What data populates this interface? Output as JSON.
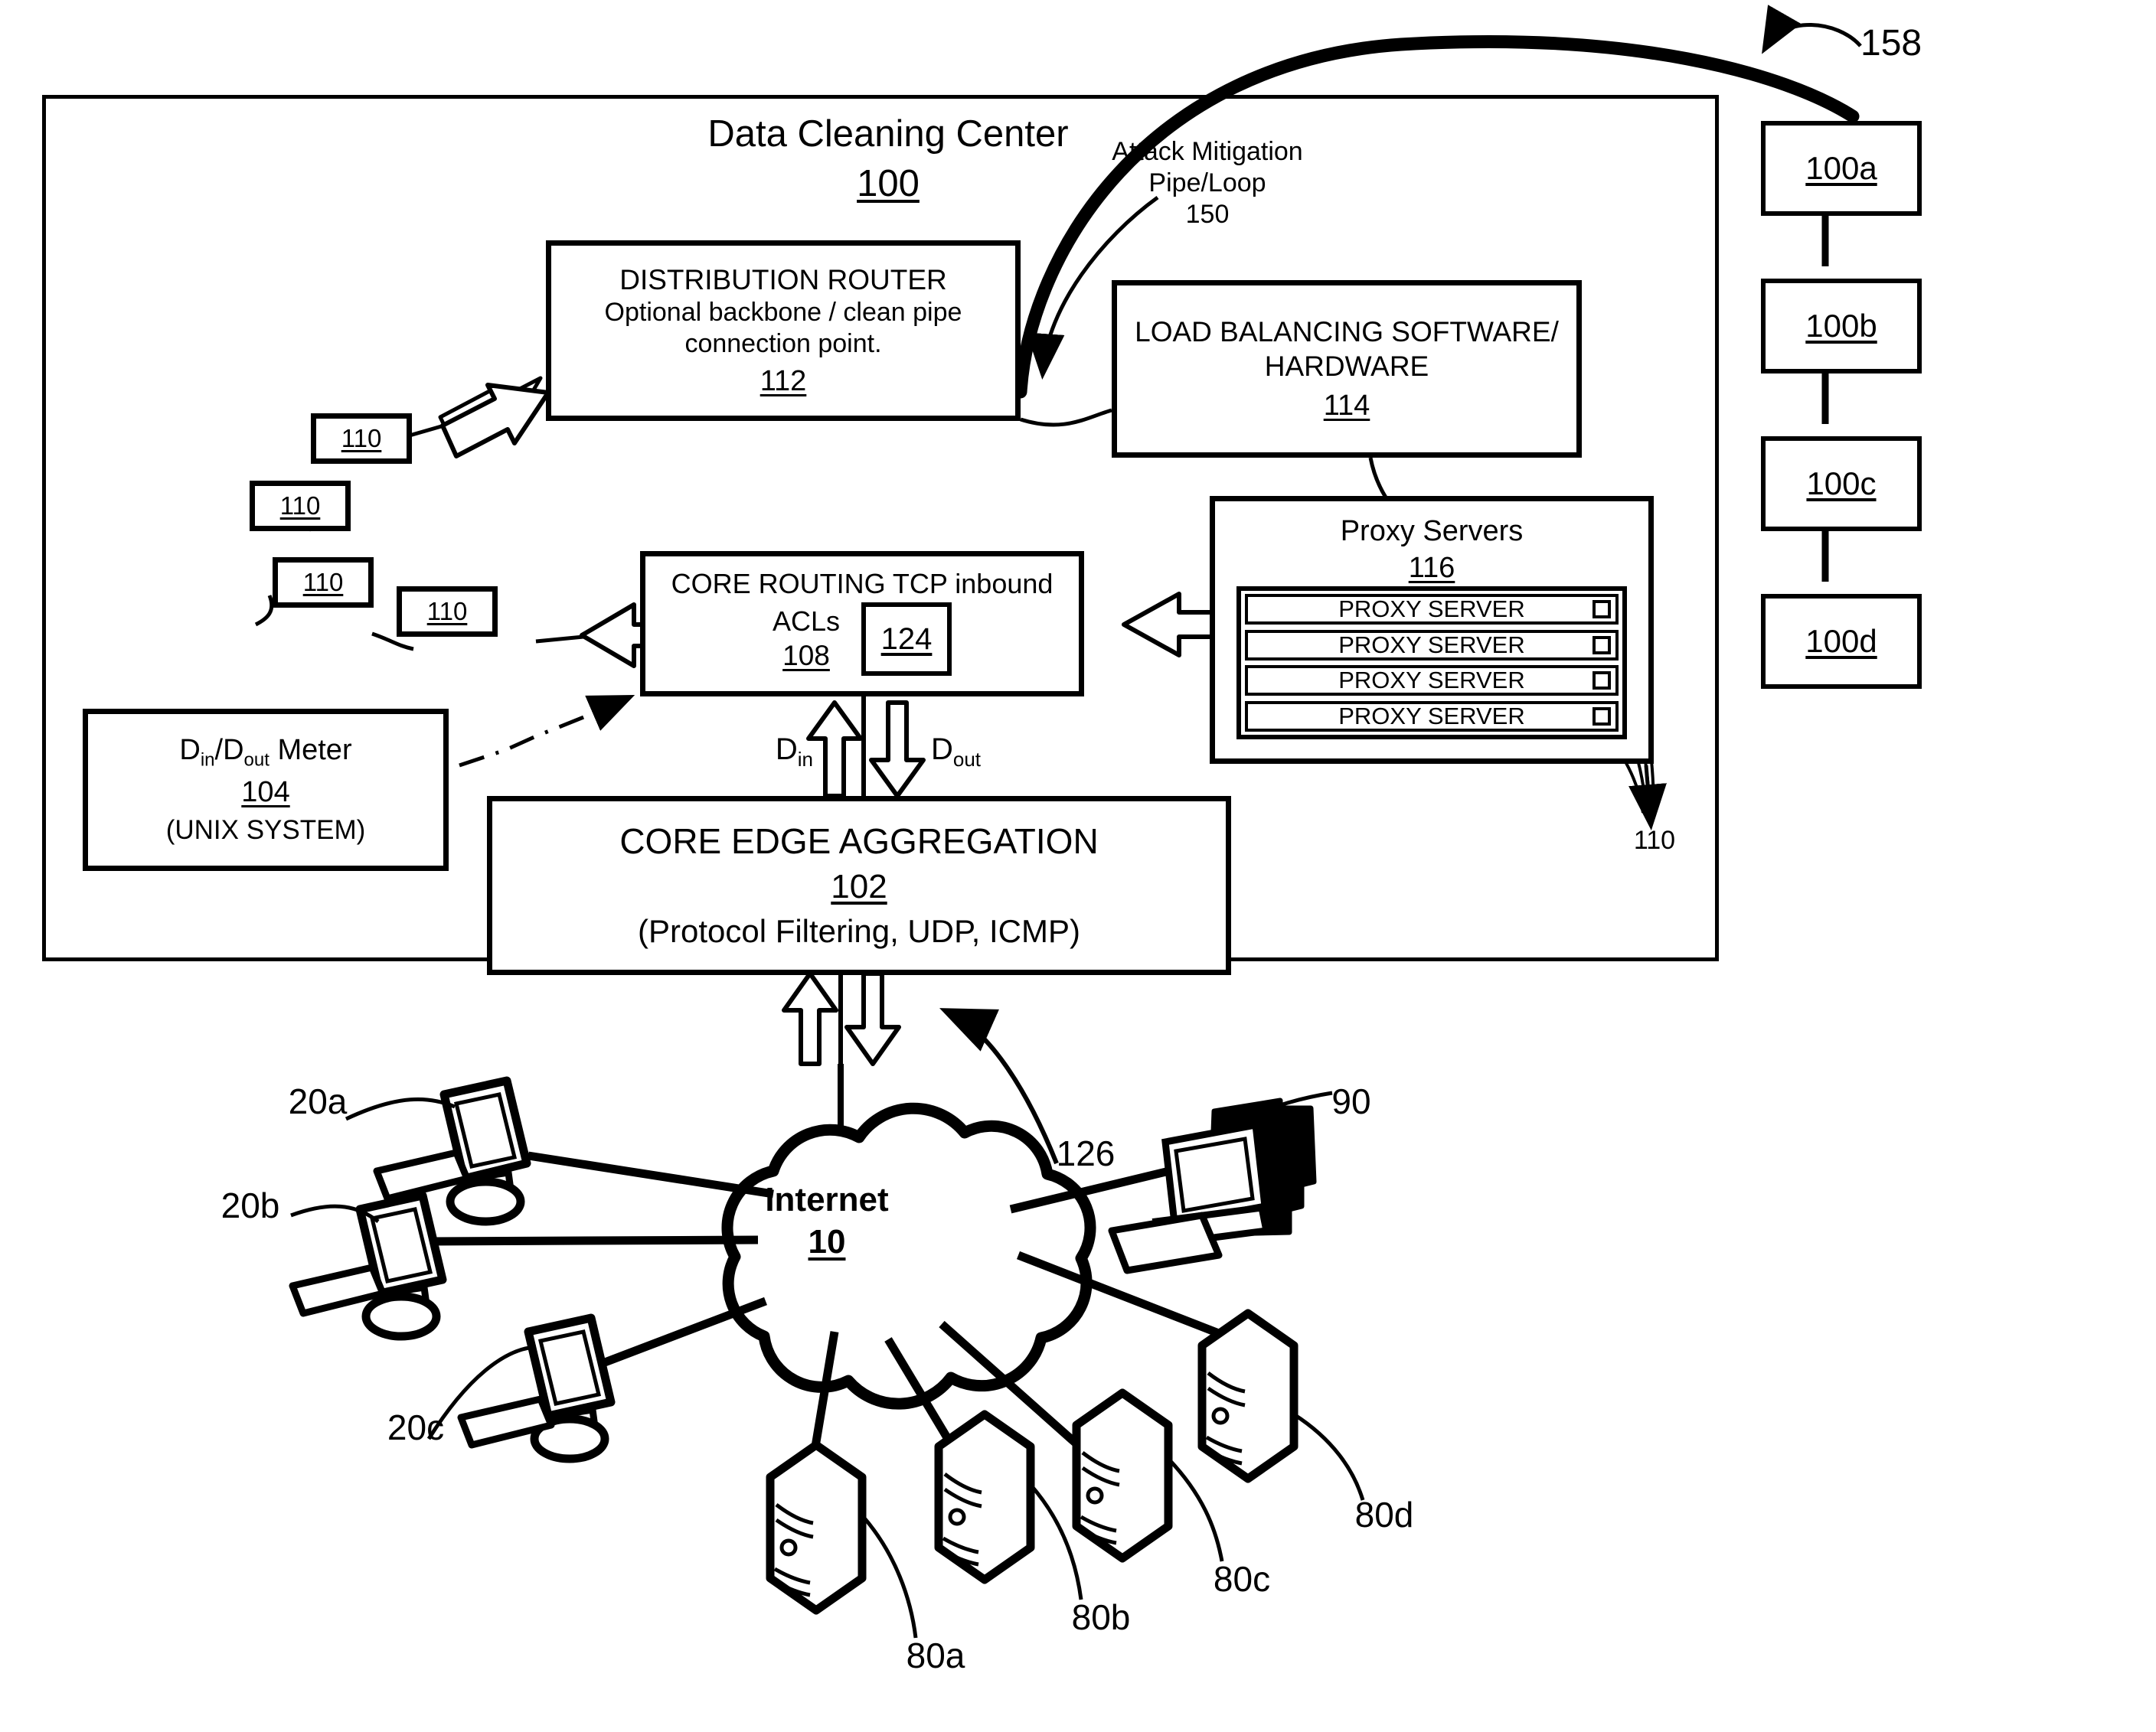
{
  "figure": {
    "center": {
      "title": "Data Cleaning Center",
      "ref": "100"
    },
    "pipe_label": {
      "line1": "Attack Mitigation",
      "line2": "Pipe/Loop",
      "ref": "150"
    },
    "callout_158": "158"
  },
  "boxes": {
    "distribution_router": {
      "title": "DISTRIBUTION ROUTER",
      "line2": "Optional backbone / clean pipe",
      "line3": "connection point.",
      "ref": "112"
    },
    "load_balancing": {
      "line1": "LOAD BALANCING SOFTWARE/",
      "line2": "HARDWARE",
      "ref": "114"
    },
    "core_routing": {
      "line1": "CORE ROUTING TCP inbound",
      "line2": "ACLs",
      "ref": "108",
      "inner_ref": "124"
    },
    "proxy_servers": {
      "title": "Proxy Servers",
      "ref": "116",
      "rows": [
        "PROXY SERVER",
        "PROXY SERVER",
        "PROXY SERVER",
        "PROXY SERVER"
      ],
      "rack_ref": "110"
    },
    "meter": {
      "title_pre": "D",
      "title_sub1": "in",
      "title_mid": "/D",
      "title_sub2": "out",
      "title_post": " Meter",
      "ref": "104",
      "sub": "(UNIX SYSTEM)"
    },
    "core_edge": {
      "title": "CORE EDGE AGGREGATION",
      "ref": "102",
      "sub": "(Protocol Filtering, UDP, ICMP)"
    }
  },
  "flow_labels": {
    "d_in": "D",
    "d_in_sub": "in",
    "d_out": "D",
    "d_out_sub": "out"
  },
  "routers_110": [
    "110",
    "110",
    "110",
    "110"
  ],
  "stack_100": [
    "100a",
    "100b",
    "100c",
    "100d"
  ],
  "cloud": {
    "name": "Internet",
    "ref": "10"
  },
  "endpoint_labels": {
    "workstation_a": "20a",
    "workstation_b": "20b",
    "workstation_c": "20c",
    "attacker_pc": "90",
    "link_126": "126",
    "server_a": "80a",
    "server_b": "80b",
    "server_c": "80c",
    "server_d": "80d"
  },
  "colors": {
    "ink": "#000000",
    "paper": "#ffffff"
  }
}
